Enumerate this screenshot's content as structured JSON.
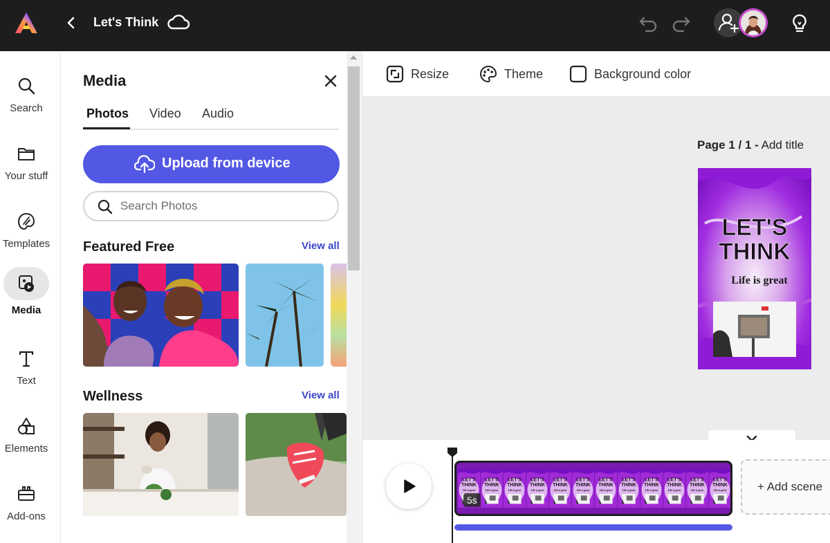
{
  "app": {
    "document_title": "Let's Think"
  },
  "rail": {
    "items": [
      {
        "label": "Search",
        "icon": "search-icon"
      },
      {
        "label": "Your stuff",
        "icon": "folder-icon"
      },
      {
        "label": "Templates",
        "icon": "templates-icon"
      },
      {
        "label": "Media",
        "icon": "media-icon",
        "active": true
      },
      {
        "label": "Text",
        "icon": "text-icon"
      },
      {
        "label": "Elements",
        "icon": "elements-icon"
      },
      {
        "label": "Add-ons",
        "icon": "addons-icon"
      }
    ]
  },
  "panel": {
    "title": "Media",
    "tabs": [
      {
        "label": "Photos",
        "active": true
      },
      {
        "label": "Video"
      },
      {
        "label": "Audio"
      }
    ],
    "upload_label": "Upload from device",
    "search_placeholder": "Search Photos",
    "sections": [
      {
        "title": "Featured Free",
        "view_all": "View all"
      },
      {
        "title": "Wellness",
        "view_all": "View all"
      }
    ]
  },
  "toolbar": {
    "resize": "Resize",
    "theme": "Theme",
    "background_color": "Background color"
  },
  "canvas": {
    "page_label": "Page 1 / 1 -",
    "add_title": "Add title",
    "design": {
      "heading_line1": "LET'S",
      "heading_line2": "THINK",
      "subtitle": "Life is great"
    }
  },
  "timeline": {
    "clip_duration": "5s",
    "frame_count": 12,
    "frame_heading_1": "LET'S",
    "frame_heading_2": "THINK",
    "frame_subtitle": "Life is great",
    "add_scene": "+ Add scene",
    "progress": 1.0
  },
  "colors": {
    "accent": "#5258e4",
    "link": "#3c46c8",
    "topbar": "#1d1d1d",
    "design_purple": "#8a1ed0"
  }
}
